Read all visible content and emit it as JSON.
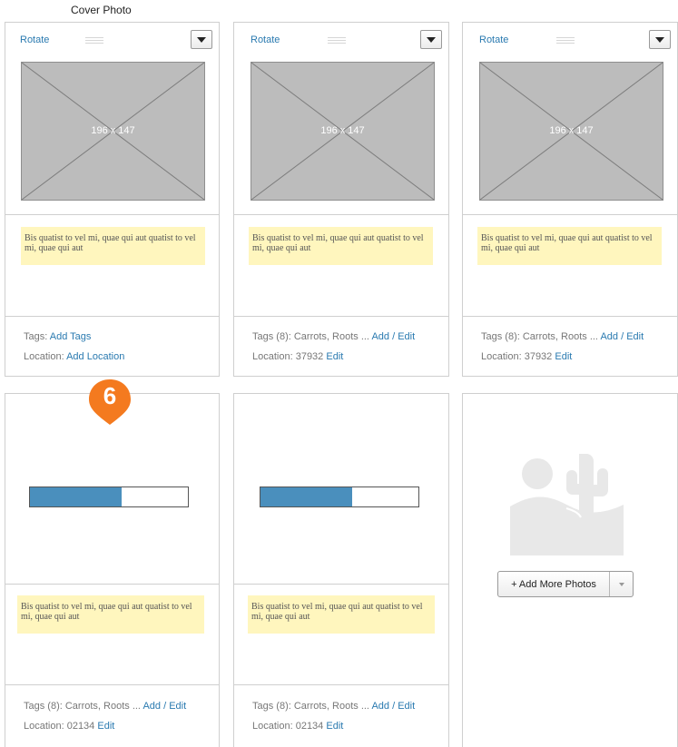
{
  "page": {
    "title": "Cover Photo"
  },
  "row1": [
    {
      "header": {
        "rotate_label": "Rotate"
      },
      "photo_label": "196 x 147",
      "caption": "Bis quatist to vel mi, quae qui aut quatist to vel mi, quae qui aut",
      "tags": {
        "prefix": "Tags: ",
        "text": "",
        "action": "Add Tags"
      },
      "location": {
        "prefix": "Location: ",
        "value": "",
        "action": "Add Location"
      }
    },
    {
      "header": {
        "rotate_label": "Rotate"
      },
      "photo_label": "196 x 147",
      "caption": "Bis quatist to vel mi, quae qui aut quatist to vel mi, quae qui aut",
      "tags": {
        "prefix": "Tags (8): ",
        "text": "Carrots, Roots ... ",
        "action": "Add / Edit"
      },
      "location": {
        "prefix": "Location: ",
        "value": "37932 ",
        "action": "Edit"
      }
    },
    {
      "header": {
        "rotate_label": "Rotate"
      },
      "photo_label": "196 x 147",
      "caption": "Bis quatist to vel mi, quae qui aut quatist to vel mi, quae qui aut",
      "tags": {
        "prefix": "Tags (8): ",
        "text": "Carrots, Roots ... ",
        "action": "Add / Edit"
      },
      "location": {
        "prefix": "Location: ",
        "value": "37932 ",
        "action": "Edit"
      }
    }
  ],
  "row2": [
    {
      "upload_progress": 0.58,
      "caption": "Bis quatist to vel mi, quae qui aut quatist to vel mi, quae qui aut",
      "tags": {
        "prefix": "Tags (8): ",
        "text": "Carrots, Roots ... ",
        "action": "Add / Edit"
      },
      "location": {
        "prefix": "Location: ",
        "value": "02134 ",
        "action": "Edit"
      }
    },
    {
      "upload_progress": 0.58,
      "caption": "Bis quatist to vel mi, quae qui aut quatist to vel mi, quae qui aut",
      "tags": {
        "prefix": "Tags (8): ",
        "text": "Carrots, Roots ... ",
        "action": "Add / Edit"
      },
      "location": {
        "prefix": "Location: ",
        "value": "02134 ",
        "action": "Edit"
      }
    }
  ],
  "add_more": {
    "label": "+ Add More Photos",
    "placeholder_icon": "desert-landscape-icon"
  },
  "annotation": {
    "number": "6",
    "color": "#f47a1f"
  },
  "colors": {
    "link": "#2a7ab0",
    "caption_bg": "#fff6be",
    "progress_fill": "#4a8fbd"
  }
}
